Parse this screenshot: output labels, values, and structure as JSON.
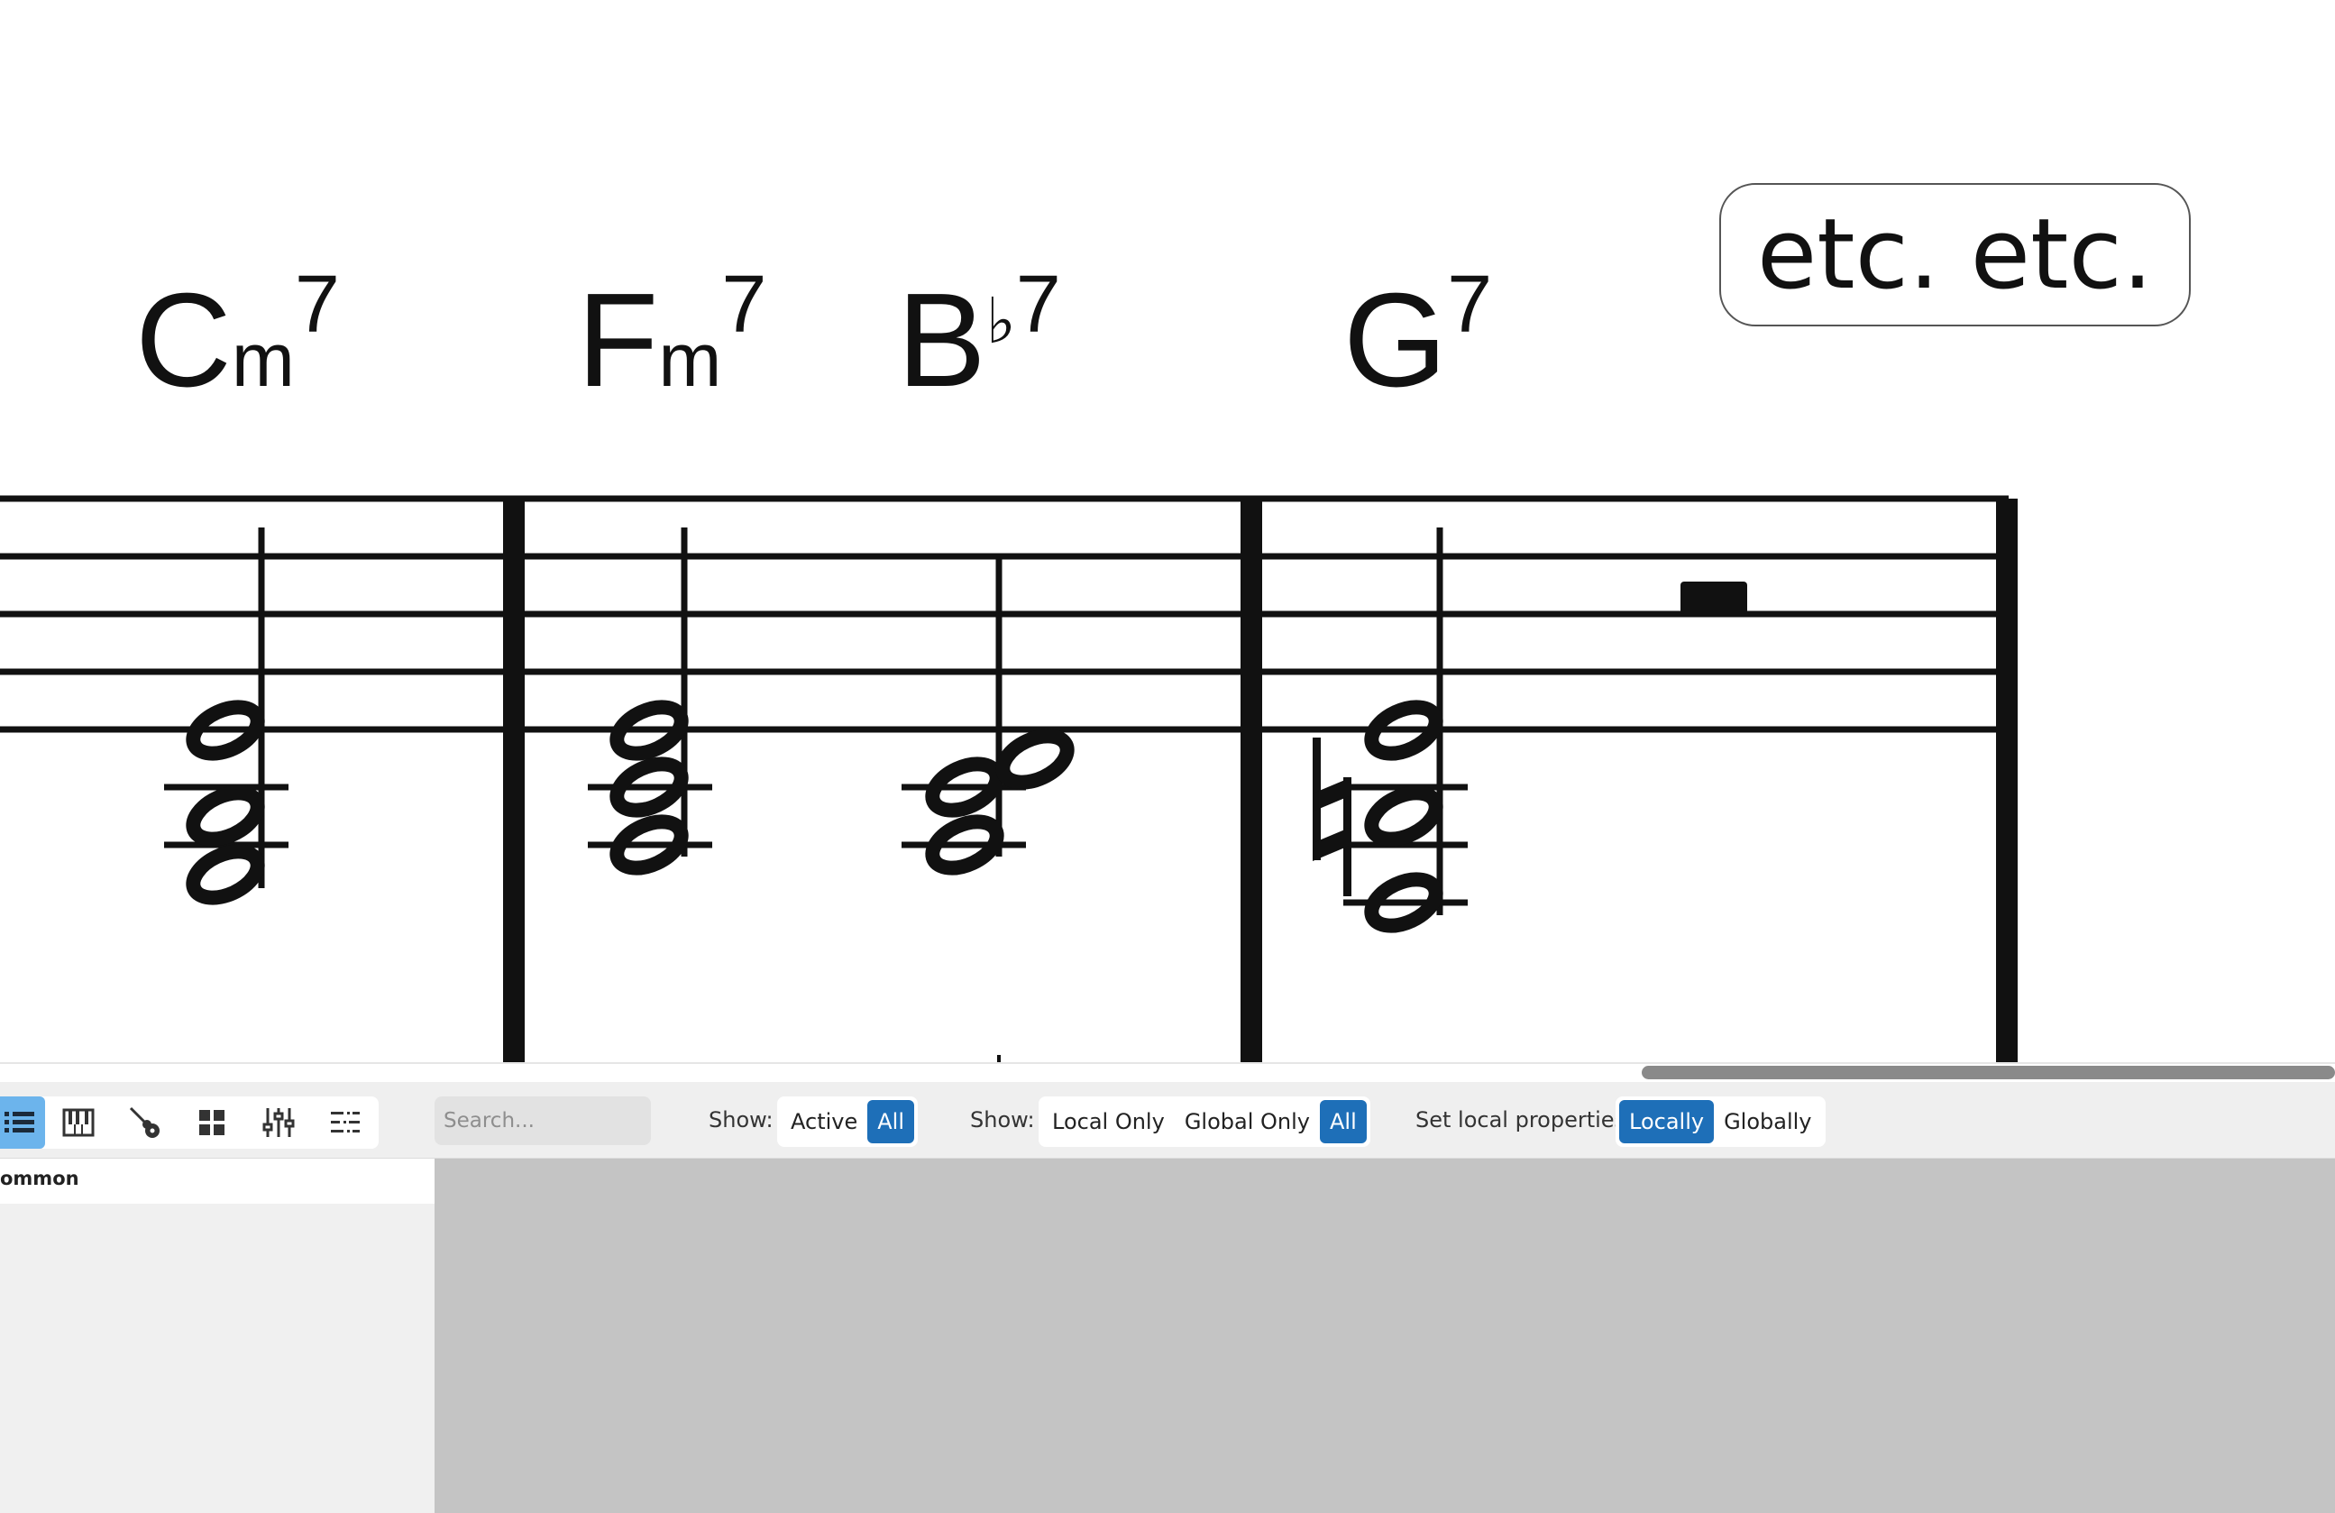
{
  "score": {
    "chords": [
      {
        "root": "C",
        "quality": "m",
        "ext": "7"
      },
      {
        "root": "F",
        "quality": "m",
        "ext": "7"
      },
      {
        "root": "B",
        "quality": "♭",
        "ext": "7"
      },
      {
        "root": "G",
        "quality": "",
        "ext": "7"
      }
    ],
    "text_box": "etc. etc."
  },
  "toolbar": {
    "icons": [
      "list-icon",
      "piano-icon",
      "guitar-icon",
      "grid-icon",
      "mixer-icon",
      "outline-icon"
    ],
    "search_placeholder": "Search...",
    "show_label_1": "Show:",
    "show_options_1": [
      "Active",
      "All"
    ],
    "show_label_2": "Show:",
    "show_options_2": [
      "Local Only",
      "Global Only",
      "All"
    ],
    "set_local_label": "Set local properties:",
    "set_local_options": [
      "Locally",
      "Globally"
    ]
  },
  "left_panel": {
    "header": "ommon"
  }
}
